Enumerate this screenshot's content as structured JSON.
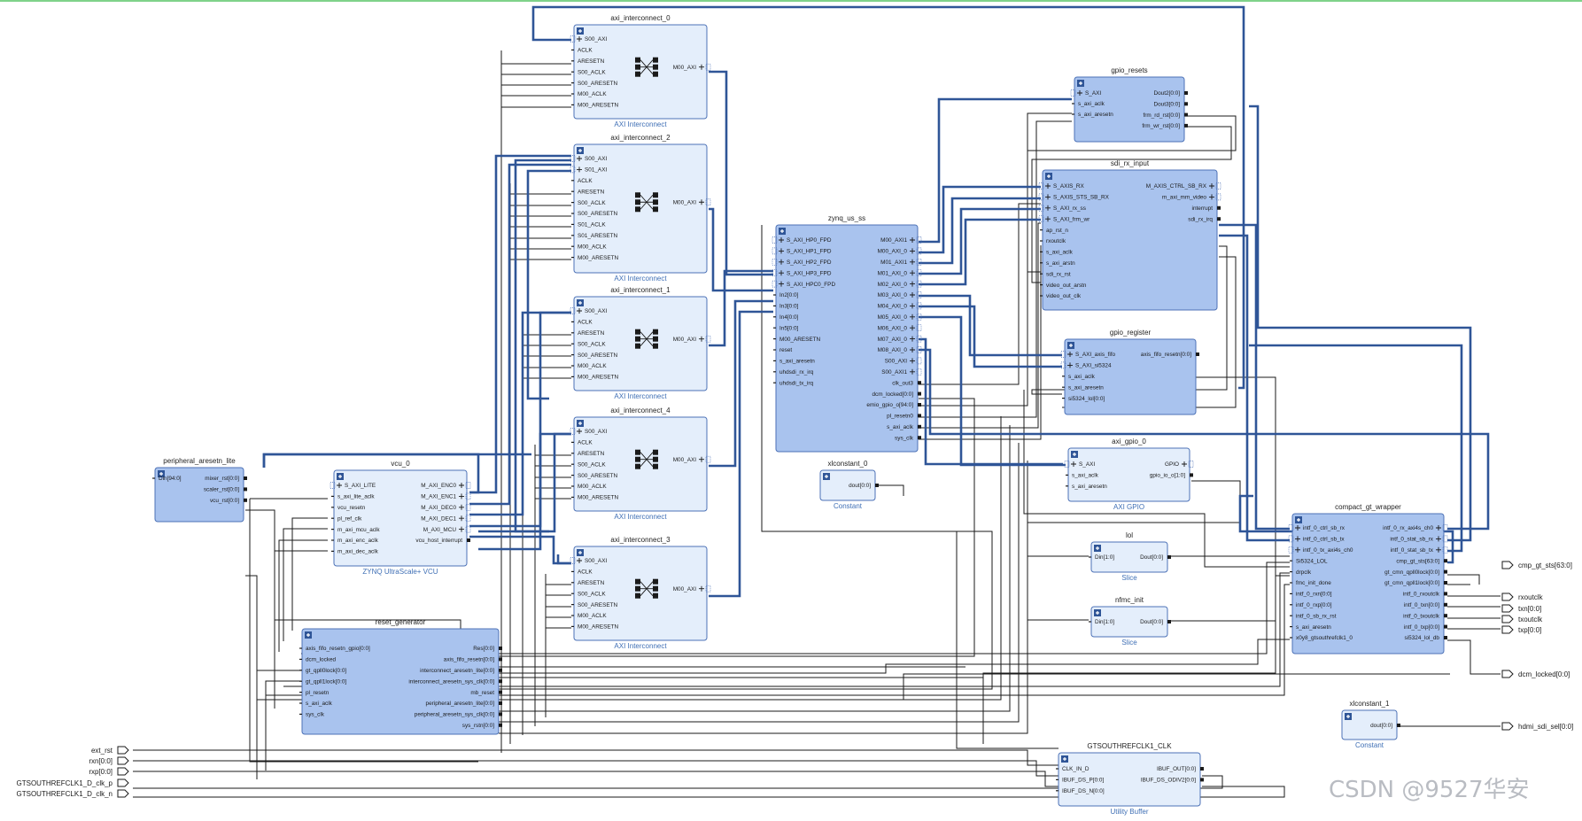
{
  "diagram": {
    "watermark": "CSDN @9527华安",
    "blocks": [
      {
        "id": "axi_interconnect_0",
        "title": "axi_interconnect_0",
        "subtitle": "AXI Interconnect",
        "left": [
          "S00_AXI",
          "ACLK",
          "ARESETN",
          "S00_ACLK",
          "S00_ARESETN",
          "M00_ACLK",
          "M00_ARESETN"
        ],
        "right": [
          "M00_AXI"
        ]
      },
      {
        "id": "axi_interconnect_2",
        "title": "axi_interconnect_2",
        "subtitle": "AXI Interconnect",
        "left": [
          "S00_AXI",
          "S01_AXI",
          "ACLK",
          "ARESETN",
          "S00_ACLK",
          "S00_ARESETN",
          "S01_ACLK",
          "S01_ARESETN",
          "M00_ACLK",
          "M00_ARESETN"
        ],
        "right": [
          "M00_AXI"
        ]
      },
      {
        "id": "axi_interconnect_1",
        "title": "axi_interconnect_1",
        "subtitle": "AXI Interconnect",
        "left": [
          "S00_AXI",
          "ACLK",
          "ARESETN",
          "S00_ACLK",
          "S00_ARESETN",
          "M00_ACLK",
          "M00_ARESETN"
        ],
        "right": [
          "M00_AXI"
        ]
      },
      {
        "id": "axi_interconnect_4",
        "title": "axi_interconnect_4",
        "subtitle": "AXI Interconnect",
        "left": [
          "S00_AXI",
          "ACLK",
          "ARESETN",
          "S00_ACLK",
          "S00_ARESETN",
          "M00_ACLK",
          "M00_ARESETN"
        ],
        "right": [
          "M00_AXI"
        ]
      },
      {
        "id": "axi_interconnect_3",
        "title": "axi_interconnect_3",
        "subtitle": "AXI Interconnect",
        "left": [
          "S00_AXI",
          "ACLK",
          "ARESETN",
          "S00_ACLK",
          "S00_ARESETN",
          "M00_ACLK",
          "M00_ARESETN"
        ],
        "right": [
          "M00_AXI"
        ]
      },
      {
        "id": "zynq_us_ss",
        "title": "zynq_us_ss",
        "subtitle": "",
        "left": [
          "S_AXI_HP0_FPD",
          "S_AXI_HP1_FPD",
          "S_AXI_HP2_FPD",
          "S_AXI_HP3_FPD",
          "S_AXI_HPC0_FPD",
          "In2[0:0]",
          "In3[0:0]",
          "In4[0:0]",
          "In5[0:0]",
          "M00_ARESETN",
          "reset",
          "s_axi_aresetn",
          "uhdsdi_rx_irq",
          "uhdsdi_tx_irq"
        ],
        "right": [
          "M00_AXI1",
          "M00_AXI_0",
          "M01_AXI1",
          "M01_AXI_0",
          "M02_AXI_0",
          "M03_AXI_0",
          "M04_AXI_0",
          "M05_AXI_0",
          "M06_AXI_0",
          "M07_AXI_0",
          "M08_AXI_0",
          "S00_AXI",
          "S00_AXI1",
          "clk_out3",
          "dcm_locked[0:0]",
          "emio_gpio_o[94:0]",
          "pl_resetn0",
          "s_axi_aclk",
          "sys_clk"
        ]
      },
      {
        "id": "xlconstant_0",
        "title": "xlconstant_0",
        "subtitle": "Constant",
        "left": [],
        "right": [
          "dout[0:0]"
        ]
      },
      {
        "id": "gpio_resets",
        "title": "gpio_resets",
        "subtitle": "",
        "left": [
          "S_AXI",
          "s_axi_aclk",
          "s_axi_aresetn"
        ],
        "right": [
          "Dout2[0:0]",
          "Dout3[0:0]",
          "frm_rd_rst[0:0]",
          "frm_wr_rst[0:0]"
        ]
      },
      {
        "id": "sdi_rx_input",
        "title": "sdi_rx_input",
        "subtitle": "",
        "left": [
          "S_AXIS_RX",
          "S_AXIS_STS_SB_RX",
          "S_AXI_rx_ss",
          "S_AXI_frm_wr",
          "ap_rst_n",
          "rxoutclk",
          "s_axi_aclk",
          "s_axi_arstn",
          "sdi_rx_rst",
          "video_out_arstn",
          "video_out_clk"
        ],
        "right": [
          "M_AXIS_CTRL_SB_RX",
          "m_axi_mm_video",
          "interrupt",
          "sdi_rx_irq"
        ]
      },
      {
        "id": "gpio_register",
        "title": "gpio_register",
        "subtitle": "",
        "left": [
          "S_AXI_axis_fifo",
          "S_AXI_si5324",
          "s_axi_aclk",
          "s_axi_aresetn",
          "si5324_lol[0:0]"
        ],
        "right": [
          "axis_fifo_resetn[0:0]"
        ]
      },
      {
        "id": "axi_gpio_0",
        "title": "axi_gpio_0",
        "subtitle": "AXI GPIO",
        "left": [
          "S_AXI",
          "s_axi_aclk",
          "s_axi_aresetn"
        ],
        "right": [
          "GPIO",
          "gpio_io_o[1:0]"
        ]
      },
      {
        "id": "lol",
        "title": "lol",
        "subtitle": "Slice",
        "left": [
          "Din[1:0]"
        ],
        "right": [
          "Dout[0:0]"
        ]
      },
      {
        "id": "nfmc_init",
        "title": "nfmc_init",
        "subtitle": "Slice",
        "left": [
          "Din[1:0]"
        ],
        "right": [
          "Dout[0:0]"
        ]
      },
      {
        "id": "compact_gt_wrapper",
        "title": "compact_gt_wrapper",
        "subtitle": "",
        "left": [
          "intf_0_ctrl_sb_rx",
          "intf_0_ctrl_sb_tx",
          "intf_0_tx_axi4s_ch0",
          "Si5324_LOL",
          "drpclk",
          "fmc_init_done",
          "intf_0_rxn[0:0]",
          "intf_0_rxp[0:0]",
          "intf_0_sb_rx_rst",
          "s_axi_aresetn",
          "x0y8_gtsouthrefclk1_0"
        ],
        "right": [
          "intf_0_rx_axi4s_ch0",
          "intf_0_stat_sb_rx",
          "intf_0_stat_sb_tx",
          "cmp_gt_sts[63:0]",
          "gt_cmn_qpll0lock[0:0]",
          "gt_cmn_qpll1lock[0:0]",
          "intf_0_rxoutclk",
          "intf_0_txn[0:0]",
          "intf_0_txoutclk",
          "intf_0_txp[0:0]",
          "si5324_lol_db"
        ]
      },
      {
        "id": "peripheral_aresetn_lite",
        "title": "peripheral_aresetn_lite",
        "subtitle": "",
        "left": [
          "Din[94:0]"
        ],
        "right": [
          "mixer_rst[0:0]",
          "scaler_rst[0:0]",
          "vcu_rst[0:0]"
        ]
      },
      {
        "id": "vcu_0",
        "title": "vcu_0",
        "subtitle": "ZYNQ UltraScale+ VCU",
        "left": [
          "S_AXI_LITE",
          "s_axi_lite_aclk",
          "vcu_resetn",
          "pl_ref_clk",
          "m_axi_mcu_aclk",
          "m_axi_enc_aclk",
          "m_axi_dec_aclk"
        ],
        "right": [
          "M_AXI_ENC0",
          "M_AXI_ENC1",
          "M_AXI_DEC0",
          "M_AXI_DEC1",
          "M_AXI_MCU",
          "vcu_host_interrupt"
        ]
      },
      {
        "id": "reset_generator",
        "title": "reset_generator",
        "subtitle": "",
        "left": [
          "axis_fifo_resetn_gpio[0:0]",
          "dcm_locked",
          "gt_qpll0lock[0:0]",
          "gt_qpll1lock[0:0]",
          "pl_resetn",
          "s_axi_aclk",
          "sys_clk"
        ],
        "right": [
          "Res[0:0]",
          "axis_fifo_resetn[0:0]",
          "interconnect_aresetn_lite[0:0]",
          "interconnect_aresetn_sys_clk[0:0]",
          "mb_reset",
          "peripheral_aresetn_lite[0:0]",
          "peripheral_aresetn_sys_clk[0:0]",
          "sys_rstn[0:0]"
        ]
      },
      {
        "id": "xlconstant_1",
        "title": "xlconstant_1",
        "subtitle": "Constant",
        "left": [],
        "right": [
          "dout[0:0]"
        ]
      },
      {
        "id": "gtsouthrefclk1_clk",
        "title": "GTSOUTHREFCLK1_CLK",
        "subtitle": "Utility Buffer",
        "left": [
          "CLK_IN_D",
          "IBUF_DS_P[0:0]",
          "IBUF_DS_N[0:0]"
        ],
        "right": [
          "IBUF_OUT[0:0]",
          "IBUF_DS_ODIV2[0:0]"
        ]
      }
    ],
    "input_ports": [
      "ext_rst",
      "rxn[0:0]",
      "rxp[0:0]",
      "GTSOUTHREFCLK1_D_clk_p",
      "GTSOUTHREFCLK1_D_clk_n"
    ],
    "output_ports": [
      "cmp_gt_sts[63:0]",
      "rxoutclk",
      "txn[0:0]",
      "txoutclk",
      "txp[0:0]",
      "dcm_locked[0:0]",
      "hdmi_sdi_sel[0:0]"
    ]
  }
}
